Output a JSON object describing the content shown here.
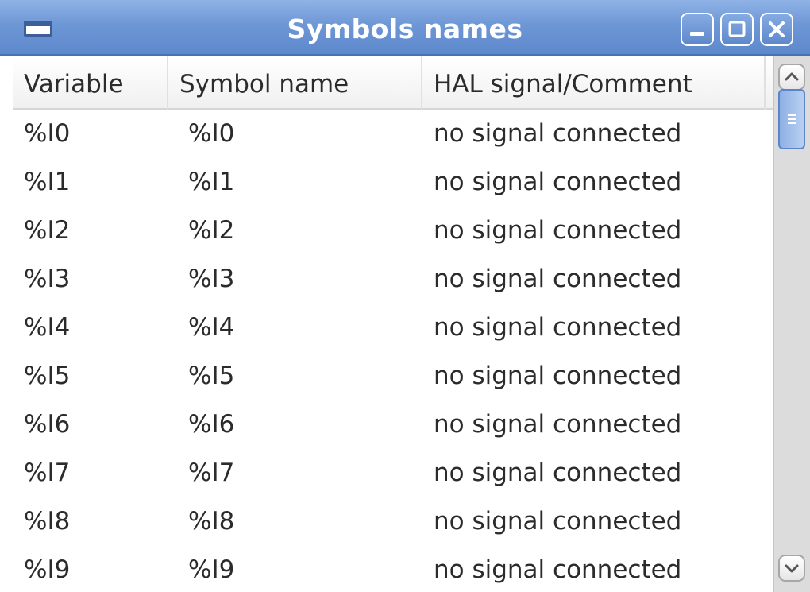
{
  "window": {
    "title": "Symbols names"
  },
  "columns": {
    "variable": "Variable",
    "symbol": "Symbol name",
    "hal": "HAL signal/Comment"
  },
  "rows": [
    {
      "variable": "%I0",
      "symbol": "%I0",
      "hal": "no signal connected"
    },
    {
      "variable": "%I1",
      "symbol": "%I1",
      "hal": "no signal connected"
    },
    {
      "variable": "%I2",
      "symbol": "%I2",
      "hal": "no signal connected"
    },
    {
      "variable": "%I3",
      "symbol": "%I3",
      "hal": "no signal connected"
    },
    {
      "variable": "%I4",
      "symbol": "%I4",
      "hal": "no signal connected"
    },
    {
      "variable": "%I5",
      "symbol": "%I5",
      "hal": "no signal connected"
    },
    {
      "variable": "%I6",
      "symbol": "%I6",
      "hal": "no signal connected"
    },
    {
      "variable": "%I7",
      "symbol": "%I7",
      "hal": "no signal connected"
    },
    {
      "variable": "%I8",
      "symbol": "%I8",
      "hal": "no signal connected"
    },
    {
      "variable": "%I9",
      "symbol": "%I9",
      "hal": "no signal connected"
    }
  ],
  "icons": {
    "window_menu": "window-menu-icon",
    "minimize": "minimize-icon",
    "maximize": "maximize-icon",
    "close": "close-icon",
    "scroll_up": "chevron-up-icon",
    "scroll_down": "chevron-down-icon"
  },
  "colors": {
    "titlebar": "#6e97d6",
    "scroll_thumb": "#8db0e4"
  }
}
